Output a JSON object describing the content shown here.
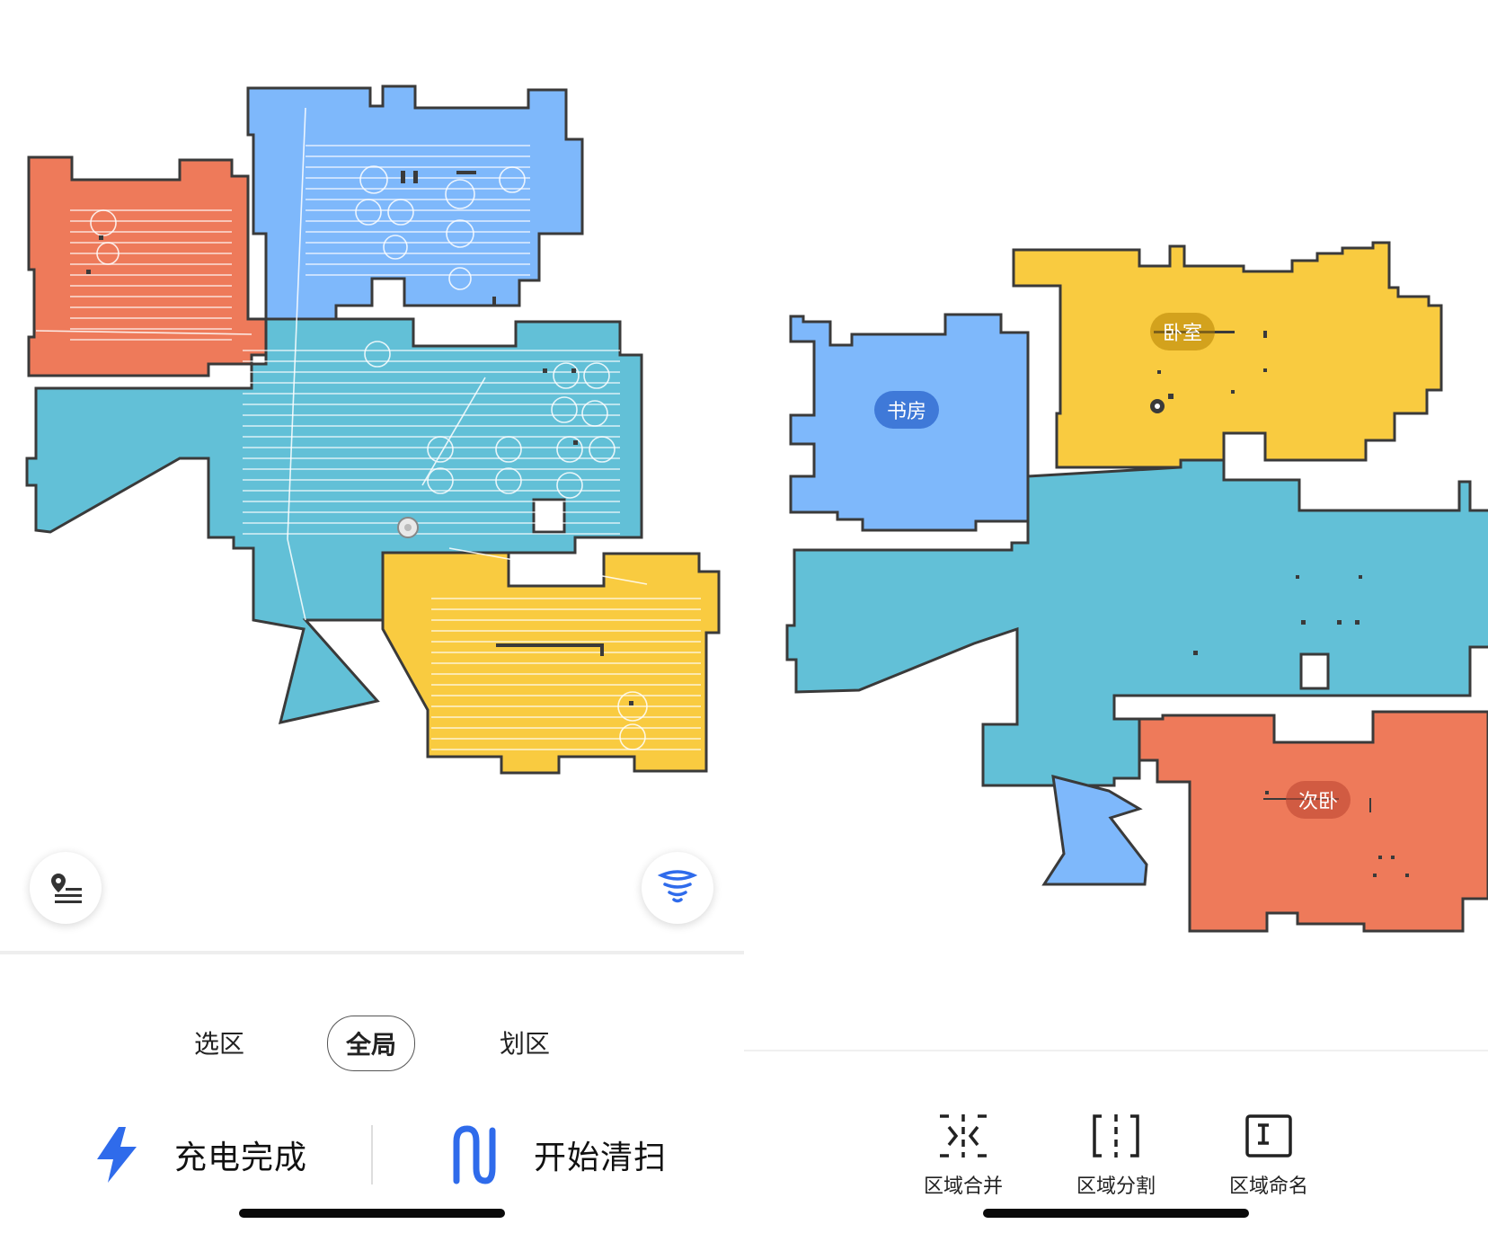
{
  "left": {
    "tabs": [
      {
        "label": "选区",
        "active": false
      },
      {
        "label": "全局",
        "active": true
      },
      {
        "label": "划区",
        "active": false
      }
    ],
    "actions": {
      "charge_status": "充电完成",
      "start_clean": "开始清扫"
    },
    "buttons": {
      "map_list_icon": "location-list-icon",
      "suction_icon": "tornado-icon"
    }
  },
  "right": {
    "rooms": [
      {
        "name": "卧室",
        "color": "#F9CB40"
      },
      {
        "name": "书房",
        "color": "#7EB8FB"
      },
      {
        "name": "次卧",
        "color": "#EE7A5A"
      }
    ],
    "tools": [
      {
        "label": "区域合并",
        "icon": "merge-icon"
      },
      {
        "label": "区域分割",
        "icon": "split-icon"
      },
      {
        "label": "区域命名",
        "icon": "rename-icon"
      }
    ]
  },
  "colors": {
    "orange": "#EE7A5A",
    "blue": "#7EB8FB",
    "teal": "#62C0D7",
    "yellow": "#F9CB40",
    "accent": "#2F6BEB",
    "wall": "#3A3A3A"
  }
}
